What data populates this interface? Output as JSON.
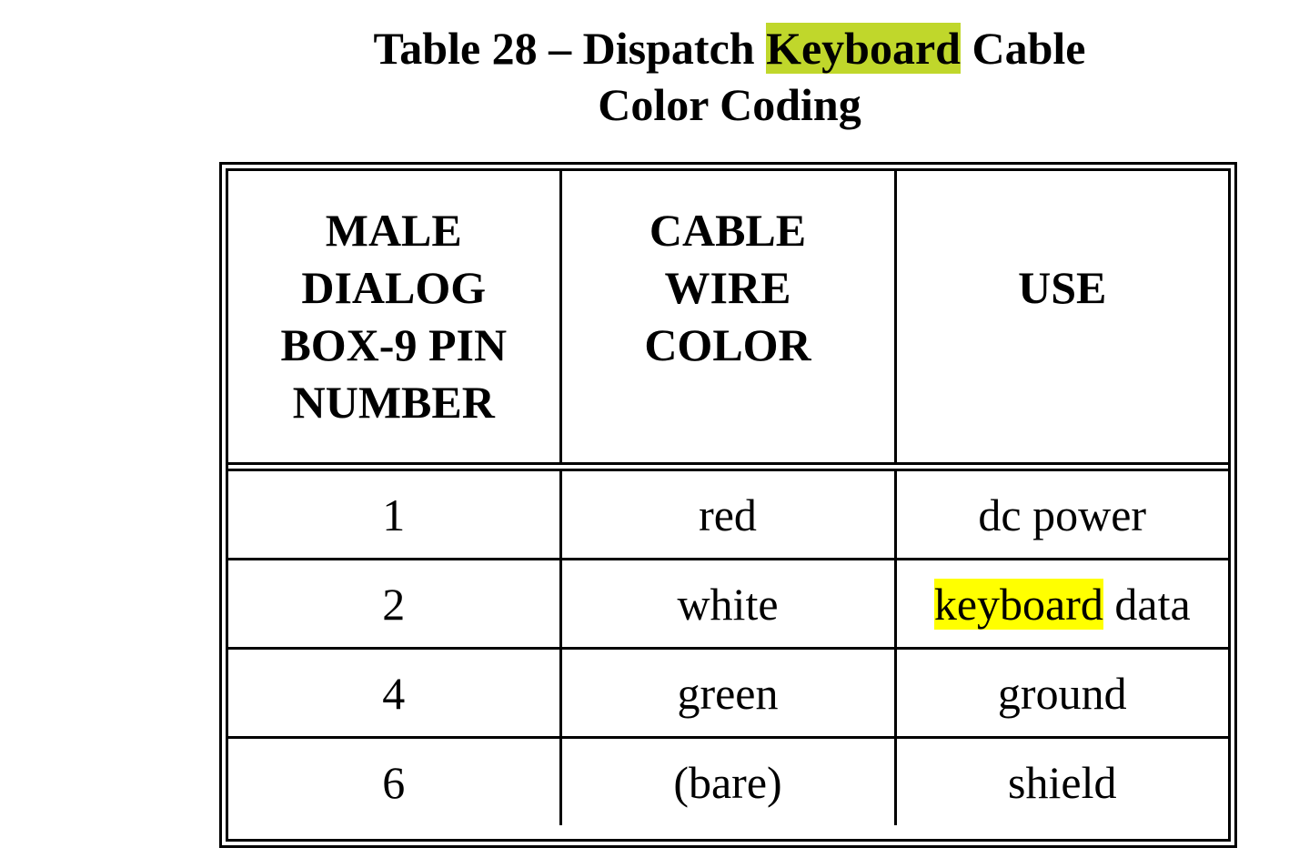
{
  "title": {
    "prefix": "Table 28 – Dispatch ",
    "highlight": "Keyboard",
    "suffix": " Cable",
    "line2": "Color Coding",
    "highlight_color": "#c0d72b"
  },
  "table": {
    "headers": [
      [
        "MALE",
        "DIALOG",
        "BOX-9 PIN",
        "NUMBER"
      ],
      [
        "CABLE",
        "WIRE",
        "COLOR"
      ],
      [
        "USE"
      ]
    ],
    "rows": [
      {
        "pin": "1",
        "color": "red",
        "use_pre": "",
        "use_highlight": "",
        "use_post": "dc power"
      },
      {
        "pin": "2",
        "color": "white",
        "use_pre": "",
        "use_highlight": "keyboard",
        "use_post": " data"
      },
      {
        "pin": "4",
        "color": "green",
        "use_pre": "",
        "use_highlight": "",
        "use_post": "ground"
      },
      {
        "pin": "6",
        "color": "(bare)",
        "use_pre": "",
        "use_highlight": "",
        "use_post": "shield"
      }
    ],
    "cell_highlight_color": "#ffff00"
  }
}
